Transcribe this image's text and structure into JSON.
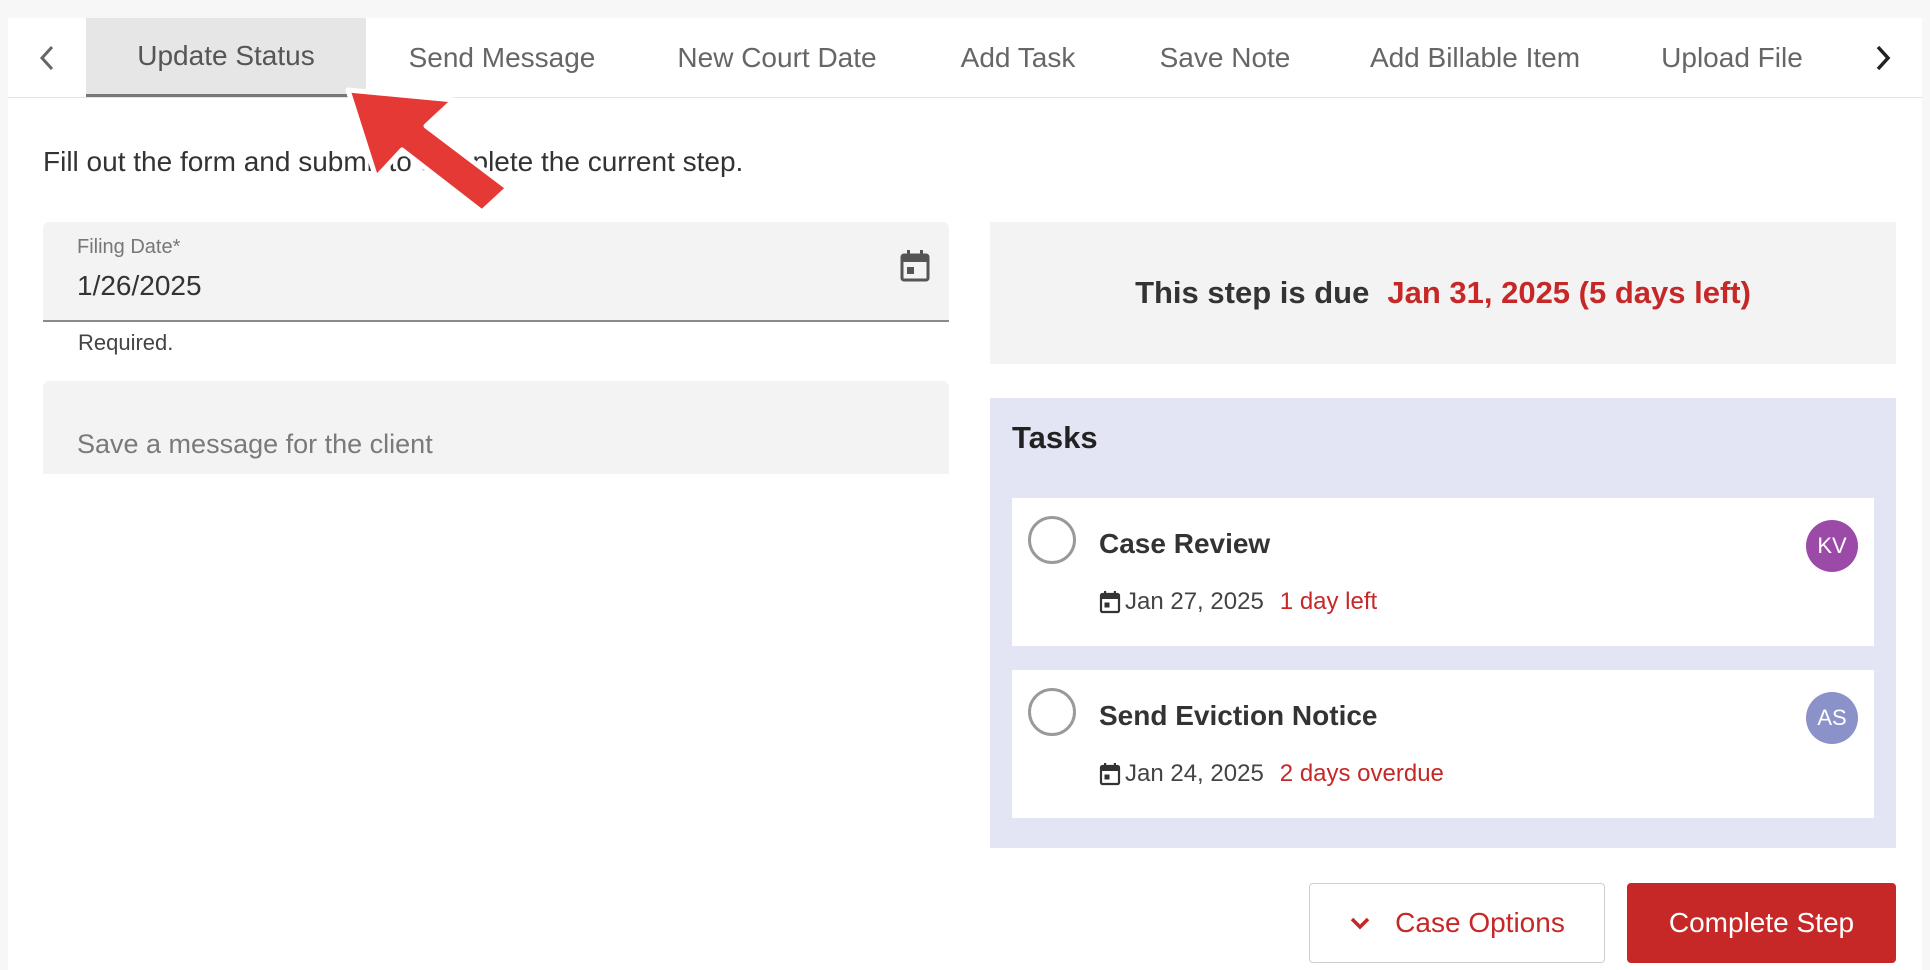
{
  "tabs": {
    "items": [
      {
        "label": "Update Status",
        "active": true
      },
      {
        "label": "Send Message",
        "active": false
      },
      {
        "label": "New Court Date",
        "active": false
      },
      {
        "label": "Add Task",
        "active": false
      },
      {
        "label": "Save Note",
        "active": false
      },
      {
        "label": "Add Billable Item",
        "active": false
      },
      {
        "label": "Upload File",
        "active": false
      }
    ],
    "prev_icon": "chevron-left-icon",
    "next_icon": "chevron-right-icon"
  },
  "instructions": "Fill out the form and submit to complete the current step.",
  "filing_date": {
    "label": "Filing Date*",
    "value": "1/26/2025",
    "helper": "Required.",
    "icon": "calendar-icon"
  },
  "message": {
    "placeholder": "Save a message for the client",
    "value": ""
  },
  "due": {
    "prefix": "This step is due",
    "date": "Jan 31, 2025 (5 days left)"
  },
  "tasks": {
    "title": "Tasks",
    "items": [
      {
        "name": "Case Review",
        "date": "Jan 27, 2025",
        "status": "1 day left",
        "assignee": "KV",
        "assignee_color": "#9b4aa8"
      },
      {
        "name": "Send Eviction Notice",
        "date": "Jan 24, 2025",
        "status": "2 days overdue",
        "assignee": "AS",
        "assignee_color": "#8a92c9"
      }
    ]
  },
  "buttons": {
    "case_options": "Case Options",
    "complete_step": "Complete Step"
  },
  "colors": {
    "accent": "#c62828",
    "tasks_bg": "#e3e5f4",
    "annotation": "#e53935"
  }
}
